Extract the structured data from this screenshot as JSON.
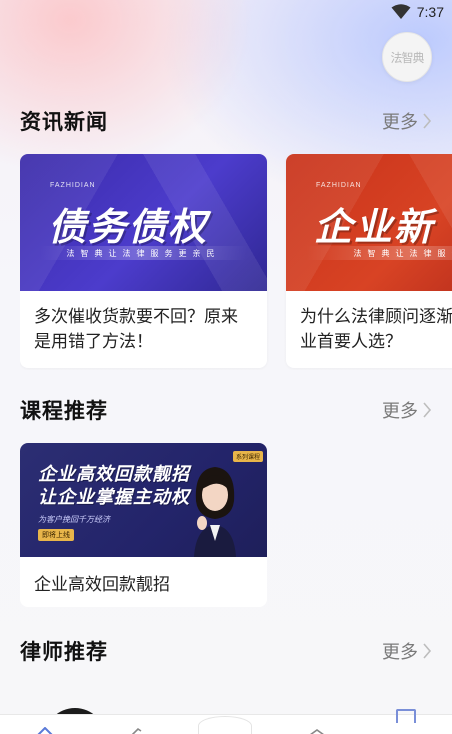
{
  "status_bar": {
    "time": "7:37",
    "wifi_icon": "wifi-icon"
  },
  "logo": {
    "text": "法智典"
  },
  "news": {
    "title": "资讯新闻",
    "more": "更多",
    "cards": [
      {
        "image_brand": "FAZHIDIAN",
        "image_headline": "债务债权",
        "image_tagline": "法智典让法律服务更亲民",
        "title": "多次催收货款要不回？原来是用错了方法！",
        "image_color": "#4233b8"
      },
      {
        "image_brand": "FAZHIDIAN",
        "image_headline": "企业新",
        "image_tagline": "法智典让法律服务",
        "title": "为什么法律顾问逐渐成为企业首要人选？",
        "image_color": "#cf3a1f"
      }
    ]
  },
  "courses": {
    "title": "课程推荐",
    "more": "更多",
    "cards": [
      {
        "image_headline_line1": "企业高效回款靓招",
        "image_headline_line2": "让企业掌握主动权",
        "image_sub": "为客户挽回千万经济",
        "image_tag": "即将上线",
        "series_tag": "系列课程",
        "title": "企业高效回款靓招"
      }
    ]
  },
  "lawyers": {
    "title": "律师推荐",
    "more": "更多"
  },
  "icons": {
    "chevron": "chevron-right-icon"
  },
  "colors": {
    "accent": "#7a8fd8",
    "news_blue": "#4233b8",
    "news_red": "#cf3a1f",
    "course_bg": "#27296d"
  }
}
